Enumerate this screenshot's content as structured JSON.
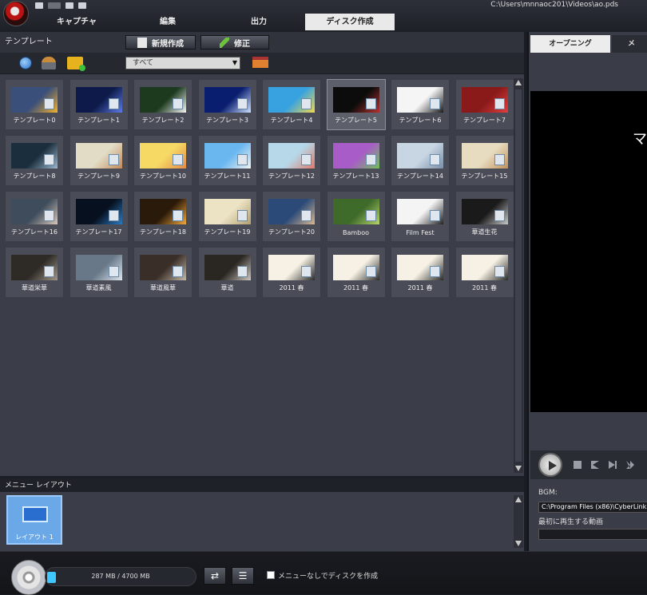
{
  "window": {
    "file_path": "C:\\Users\\mnnaoc201\\Videos\\ao.pds"
  },
  "main_tabs": [
    {
      "label": "キャプチャ"
    },
    {
      "label": "編集"
    },
    {
      "label": "出力"
    },
    {
      "label": "ディスク作成"
    }
  ],
  "template_panel": {
    "title": "テンプレート",
    "new_button": "新規作成",
    "edit_button": "修正",
    "category": "すべて"
  },
  "templates": [
    {
      "label": "テンプレート0",
      "bg": "#3a4f7a",
      "fg": "#f4b12a"
    },
    {
      "label": "テンプレート1",
      "bg": "#0d1a4a",
      "fg": "#5d7be8"
    },
    {
      "label": "テンプレート2",
      "bg": "#1d3a1f",
      "fg": "#f5f5f5"
    },
    {
      "label": "テンプレート3",
      "bg": "#0a1e70",
      "fg": "#cde0ff"
    },
    {
      "label": "テンプレート4",
      "bg": "#38a2e0",
      "fg": "#f2d84a"
    },
    {
      "label": "テンプレート5",
      "bg": "#0c0c0c",
      "fg": "#b83030"
    },
    {
      "label": "テンプレート6",
      "bg": "#f5f5f5",
      "fg": "#1a1a1a"
    },
    {
      "label": "テンプレート7",
      "bg": "#8a1a1a",
      "fg": "#e43d3d"
    },
    {
      "label": "テンプレート8",
      "bg": "#1a2e3d",
      "fg": "#9bb8d0"
    },
    {
      "label": "テンプレート9",
      "bg": "#e2dcc6",
      "fg": "#c28b58"
    },
    {
      "label": "テンプレート10",
      "bg": "#f6d864",
      "fg": "#e08b4a"
    },
    {
      "label": "テンプレート11",
      "bg": "#6ab7f0",
      "fg": "#f1f1f1"
    },
    {
      "label": "テンプレート12",
      "bg": "#b6d8e8",
      "fg": "#e07a6a"
    },
    {
      "label": "テンプレート13",
      "bg": "#a85cc8",
      "fg": "#6fc058"
    },
    {
      "label": "テンプレート14",
      "bg": "#c8d6e4",
      "fg": "#7a8ea6"
    },
    {
      "label": "テンプレート15",
      "bg": "#e8dcc0",
      "fg": "#c0915c"
    },
    {
      "label": "テンプレート16",
      "bg": "#3e4c5c",
      "fg": "#d8c8b8"
    },
    {
      "label": "テンプレート17",
      "bg": "#06101e",
      "fg": "#2c7ac2"
    },
    {
      "label": "テンプレート18",
      "bg": "#2a1a0a",
      "fg": "#f4a83a"
    },
    {
      "label": "テンプレート19",
      "bg": "#ece2c4",
      "fg": "#b0a070"
    },
    {
      "label": "テンプレート20",
      "bg": "#2c4a78",
      "fg": "#d8b890"
    },
    {
      "label": "Bamboo",
      "bg": "#3e6a2a",
      "fg": "#b6d46a"
    },
    {
      "label": "Film Fest",
      "bg": "#f4f4f4",
      "fg": "#222222"
    },
    {
      "label": "華道生花",
      "bg": "#1a1a1a",
      "fg": "#c8c8c8"
    },
    {
      "label": "華道栄華",
      "bg": "#2e2a26",
      "fg": "#a09888"
    },
    {
      "label": "華道素風",
      "bg": "#687888",
      "fg": "#dfe6ee"
    },
    {
      "label": "華道風華",
      "bg": "#3a2e28",
      "fg": "#c4b8a8"
    },
    {
      "label": "華道",
      "bg": "#2a2622",
      "fg": "#d0c8c0"
    },
    {
      "label": "2011 春",
      "bg": "#f6f1e4",
      "fg": "#2a2a2a"
    },
    {
      "label": "2011 春",
      "bg": "#f6f1e4",
      "fg": "#2a2a2a"
    },
    {
      "label": "2011 春",
      "bg": "#f6f1e4",
      "fg": "#2a2a2a"
    },
    {
      "label": "2011 春",
      "bg": "#f6f1e4",
      "fg": "#2a2a2a"
    }
  ],
  "selected_template": 5,
  "menu_layout": {
    "header": "メニュー レイアウト",
    "layout_label": "レイアウト 1"
  },
  "preview": {
    "tab_opening": "オープニング",
    "tab_menu": "メ",
    "video_text": "マ",
    "bgm_label": "BGM:",
    "bgm_path": "C:\\Program Files (x86)\\CyberLink",
    "first_play_label": "最初に再生する動画"
  },
  "bottom": {
    "capacity_text": "287 MB / 4700 MB",
    "capacity_fraction": 0.061,
    "no_menu_label": "メニューなしでディスクを作成"
  }
}
